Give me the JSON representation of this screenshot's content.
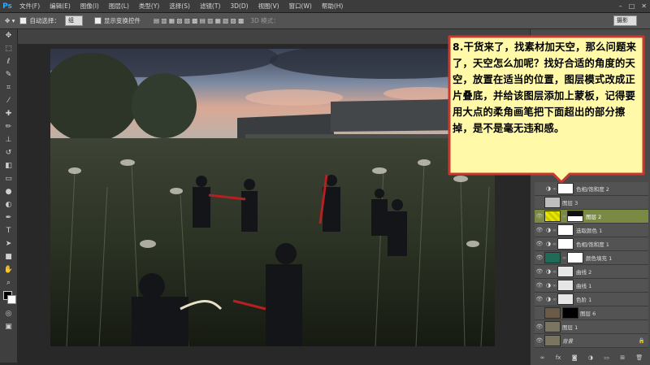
{
  "app": {
    "logo": "Ps"
  },
  "menu": [
    "文件(F)",
    "编辑(E)",
    "图像(I)",
    "图层(L)",
    "类型(Y)",
    "选择(S)",
    "滤镜(T)",
    "3D(D)",
    "视图(V)",
    "窗口(W)",
    "帮助(H)"
  ],
  "window_controls": [
    "–",
    "□",
    "✕"
  ],
  "options": {
    "auto_select_label": "自动选择：",
    "auto_select_value": "组",
    "show_transform_label": "显示变换控件",
    "mode_3d": "3D 模式：",
    "workspace": "摄影"
  },
  "callout": {
    "text": "8.干货来了，找素材加天空，那么问题来了，天空怎么加呢？找好合适的角度的天空，放置在适当的位置，图层模式改成正片叠底，并给该图层添加上蒙板，记得要用大点的柔角画笔把下面超出的部分擦掉，是不是毫无违和感。",
    "fill_color": "#fff9a8",
    "border_color": "#c7392f"
  },
  "layers": [
    {
      "name": "色相/饱和度 2",
      "visible": false,
      "type": "adjustment"
    },
    {
      "name": "图层 3",
      "visible": false,
      "type": "pixel"
    },
    {
      "name": "图层 2",
      "visible": true,
      "type": "pixel",
      "active": true
    },
    {
      "name": "选取颜色 1",
      "visible": true,
      "type": "adjustment"
    },
    {
      "name": "色相/饱和度 1",
      "visible": true,
      "type": "adjustment"
    },
    {
      "name": "颜色填充 1",
      "visible": true,
      "type": "fill"
    },
    {
      "name": "曲线 2",
      "visible": true,
      "type": "adjustment"
    },
    {
      "name": "曲线 1",
      "visible": true,
      "type": "adjustment"
    },
    {
      "name": "色阶 1",
      "visible": true,
      "type": "adjustment"
    },
    {
      "name": "图层 6",
      "visible": false,
      "type": "pixel"
    },
    {
      "name": "图层 1",
      "visible": true,
      "type": "pixel"
    },
    {
      "name": "背景",
      "visible": true,
      "type": "pixel"
    }
  ],
  "layer_footer_icons": [
    "link-icon",
    "fx-icon",
    "mask-icon",
    "adjustment-icon",
    "folder-icon",
    "new-layer-icon",
    "trash-icon"
  ],
  "colors": {
    "accent_active_layer": "#7a8a45",
    "ui_bg": "#2b2b2b"
  }
}
